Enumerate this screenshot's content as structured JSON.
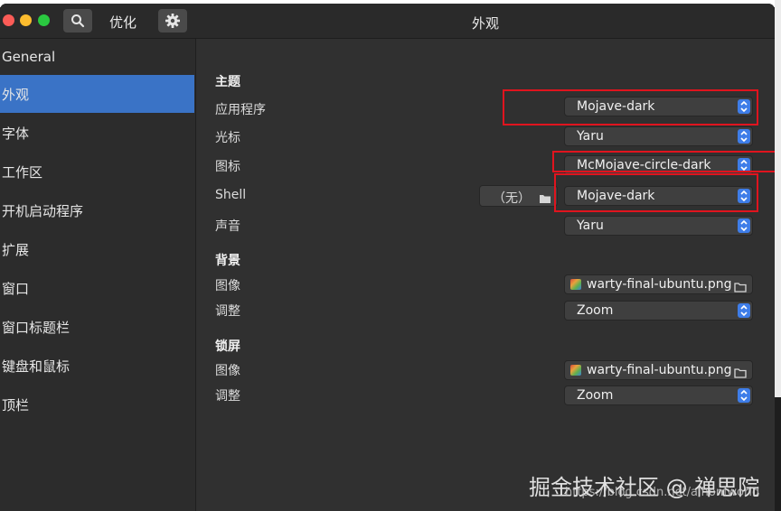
{
  "titlebar": {
    "app_title": "优化",
    "page_title": "外观"
  },
  "sidebar": {
    "items": [
      {
        "label": "General"
      },
      {
        "label": "外观"
      },
      {
        "label": "字体"
      },
      {
        "label": "工作区"
      },
      {
        "label": "开机启动程序"
      },
      {
        "label": "扩展"
      },
      {
        "label": "窗口"
      },
      {
        "label": "窗口标题栏"
      },
      {
        "label": "键盘和鼠标"
      },
      {
        "label": "顶栏"
      }
    ],
    "active": "外观"
  },
  "theme": {
    "heading": "主题",
    "app_label": "应用程序",
    "app_value": "Mojave-dark",
    "cursor_label": "光标",
    "cursor_value": "Yaru",
    "icon_label": "图标",
    "icon_value": "McMojave-circle-dark",
    "shell_label": "Shell",
    "shell_none": "（无）",
    "shell_value": "Mojave-dark",
    "sound_label": "声音",
    "sound_value": "Yaru"
  },
  "background": {
    "heading": "背景",
    "image_label": "图像",
    "image_value": "warty-final-ubuntu.png",
    "adjust_label": "调整",
    "adjust_value": "Zoom"
  },
  "lockscreen": {
    "heading": "锁屏",
    "image_label": "图像",
    "image_value": "warty-final-ubuntu.png",
    "adjust_label": "调整",
    "adjust_value": "Zoom"
  },
  "watermark": {
    "text": "掘金技术社区 @ 禅思院",
    "url": "https://blog.csdn.net/aihonfworld"
  }
}
